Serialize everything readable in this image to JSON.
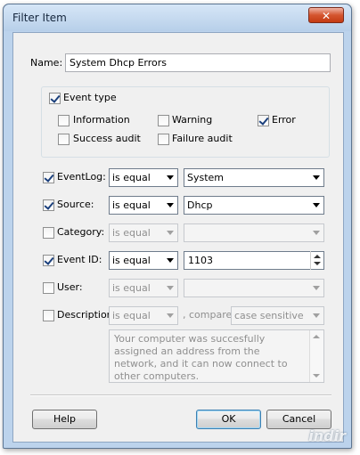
{
  "window": {
    "title": "Filter Item",
    "close_glyph": "✕"
  },
  "name": {
    "label": "Name:",
    "value": "System Dhcp Errors"
  },
  "event_type": {
    "label": "Event type",
    "checked": true,
    "items": [
      {
        "label": "Information",
        "checked": false
      },
      {
        "label": "Warning",
        "checked": false
      },
      {
        "label": "Error",
        "checked": true
      },
      {
        "label": "Success audit",
        "checked": false
      },
      {
        "label": "Failure audit",
        "checked": false
      }
    ]
  },
  "filters": {
    "eventlog": {
      "label": "EventLog:",
      "checked": true,
      "operator": "is equal",
      "value": "System"
    },
    "source": {
      "label": "Source:",
      "checked": true,
      "operator": "is equal",
      "value": "Dhcp"
    },
    "category": {
      "label": "Category:",
      "checked": false,
      "operator": "is equal",
      "value": ""
    },
    "event_id": {
      "label": "Event ID:",
      "checked": true,
      "operator": "is equal",
      "value": "1103"
    },
    "user": {
      "label": "User:",
      "checked": false,
      "operator": "is equal",
      "value": ""
    },
    "description": {
      "label": "Description:",
      "checked": false,
      "operator": "is equal",
      "compare_label": ", compare:",
      "compare_value": "case sensitive",
      "text": "Your computer was succesfully assigned an address from the network, and it can now connect to other computers."
    }
  },
  "buttons": {
    "help": "Help",
    "ok": "OK",
    "cancel": "Cancel"
  },
  "watermark": "indir"
}
